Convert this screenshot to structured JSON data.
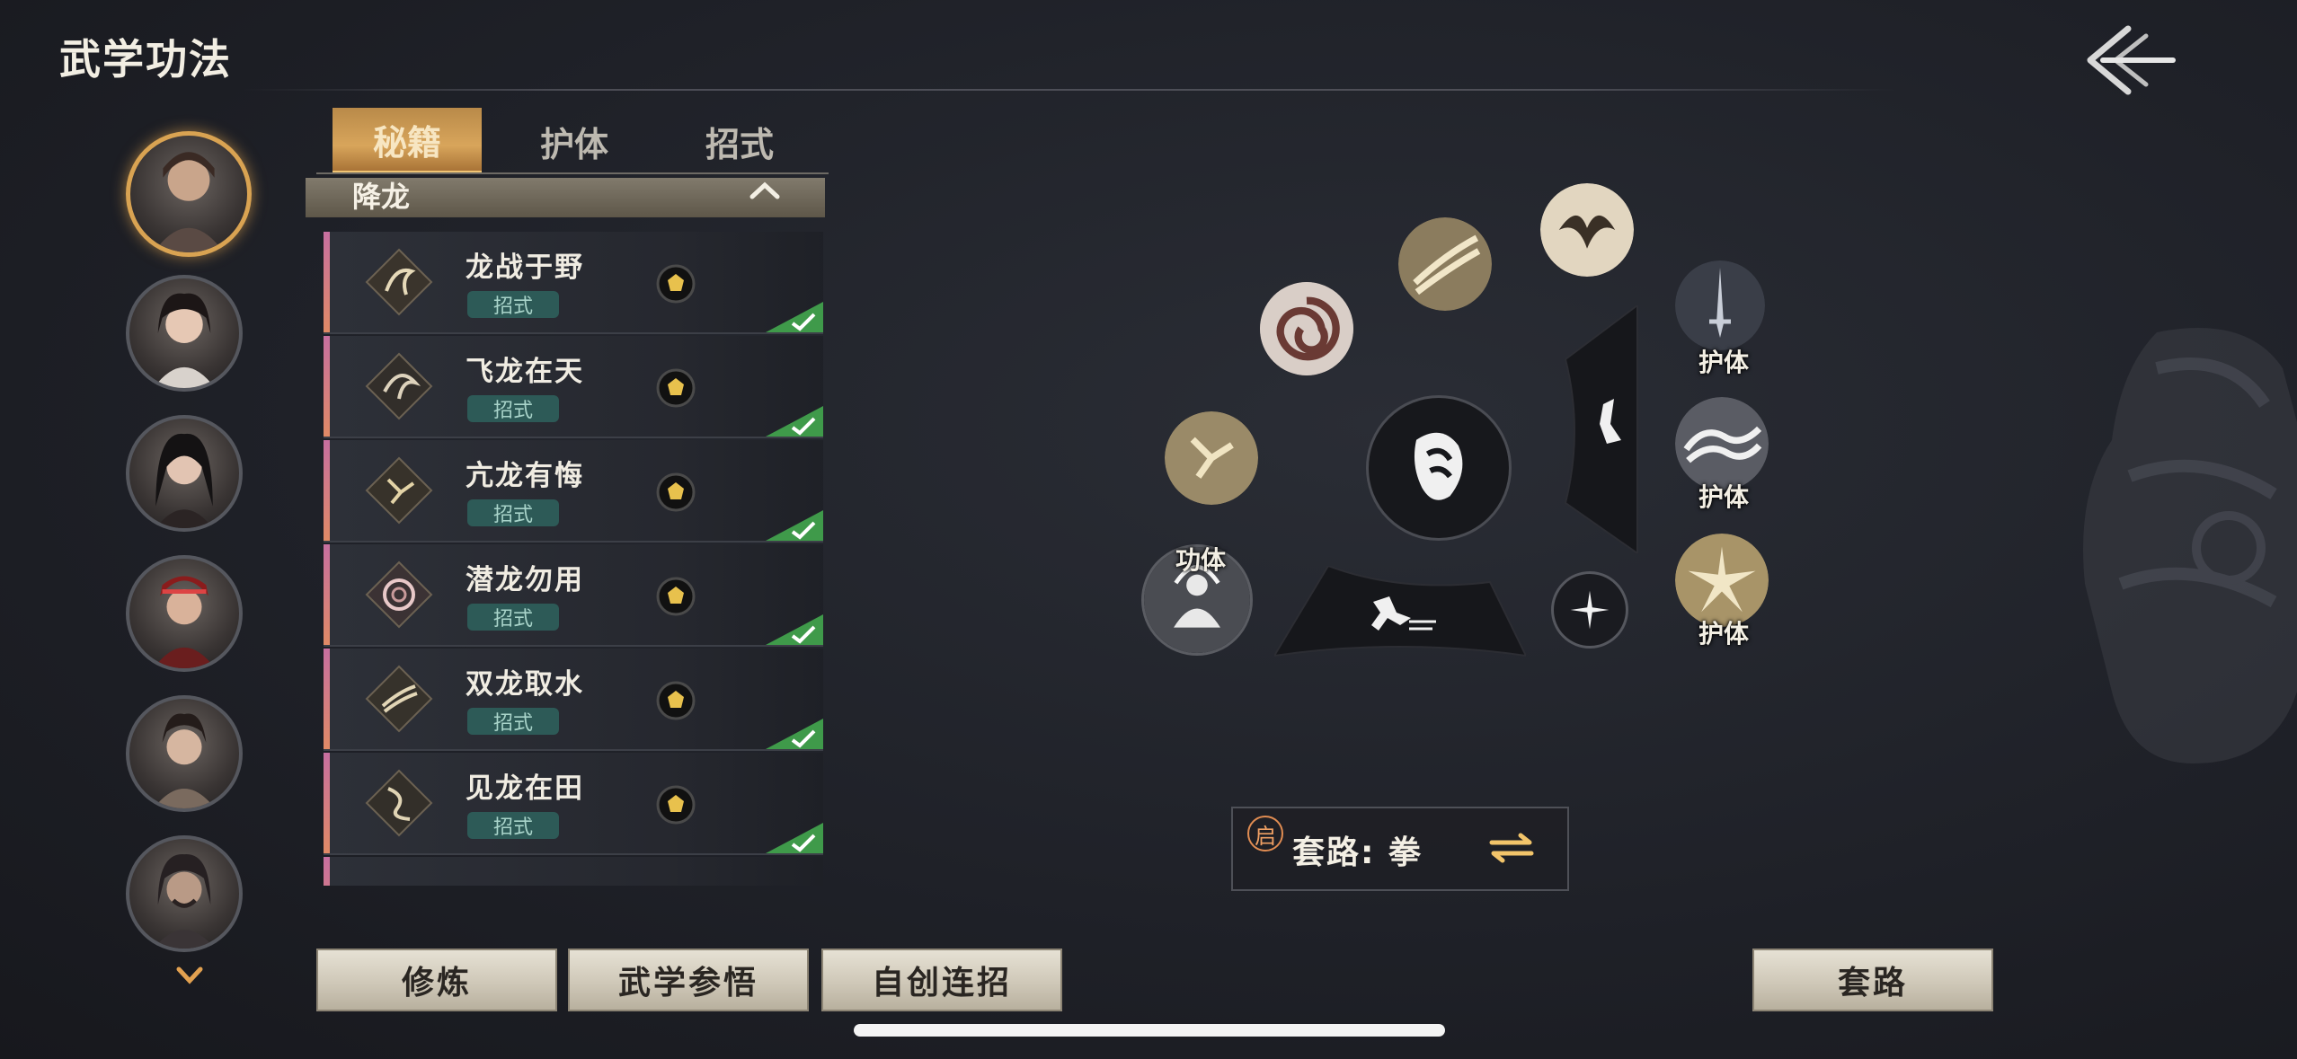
{
  "header": {
    "title": "武学功法"
  },
  "tabs": [
    "秘籍",
    "护体",
    "招式"
  ],
  "group": {
    "name": "降龙"
  },
  "skills": [
    {
      "name": "龙战于野",
      "tag": "招式"
    },
    {
      "name": "飞龙在天",
      "tag": "招式"
    },
    {
      "name": "亢龙有悔",
      "tag": "招式"
    },
    {
      "name": "潜龙勿用",
      "tag": "招式"
    },
    {
      "name": "双龙取水",
      "tag": "招式"
    },
    {
      "name": "见龙在田",
      "tag": "招式"
    }
  ],
  "wheel": {
    "labels": {
      "gongti": "功体",
      "huti1": "护体",
      "huti2": "护体",
      "huti3": "护体"
    }
  },
  "taolu": {
    "badge": "启",
    "text": "套路: 拳"
  },
  "buttons": {
    "xiulian": "修炼",
    "canwu": "武学参悟",
    "lianzhao": "自创连招",
    "taolu": "套路"
  },
  "colors": {
    "accent": "#d9a352",
    "tag_bg": "#2d5a57",
    "check": "#3f9a4a"
  }
}
